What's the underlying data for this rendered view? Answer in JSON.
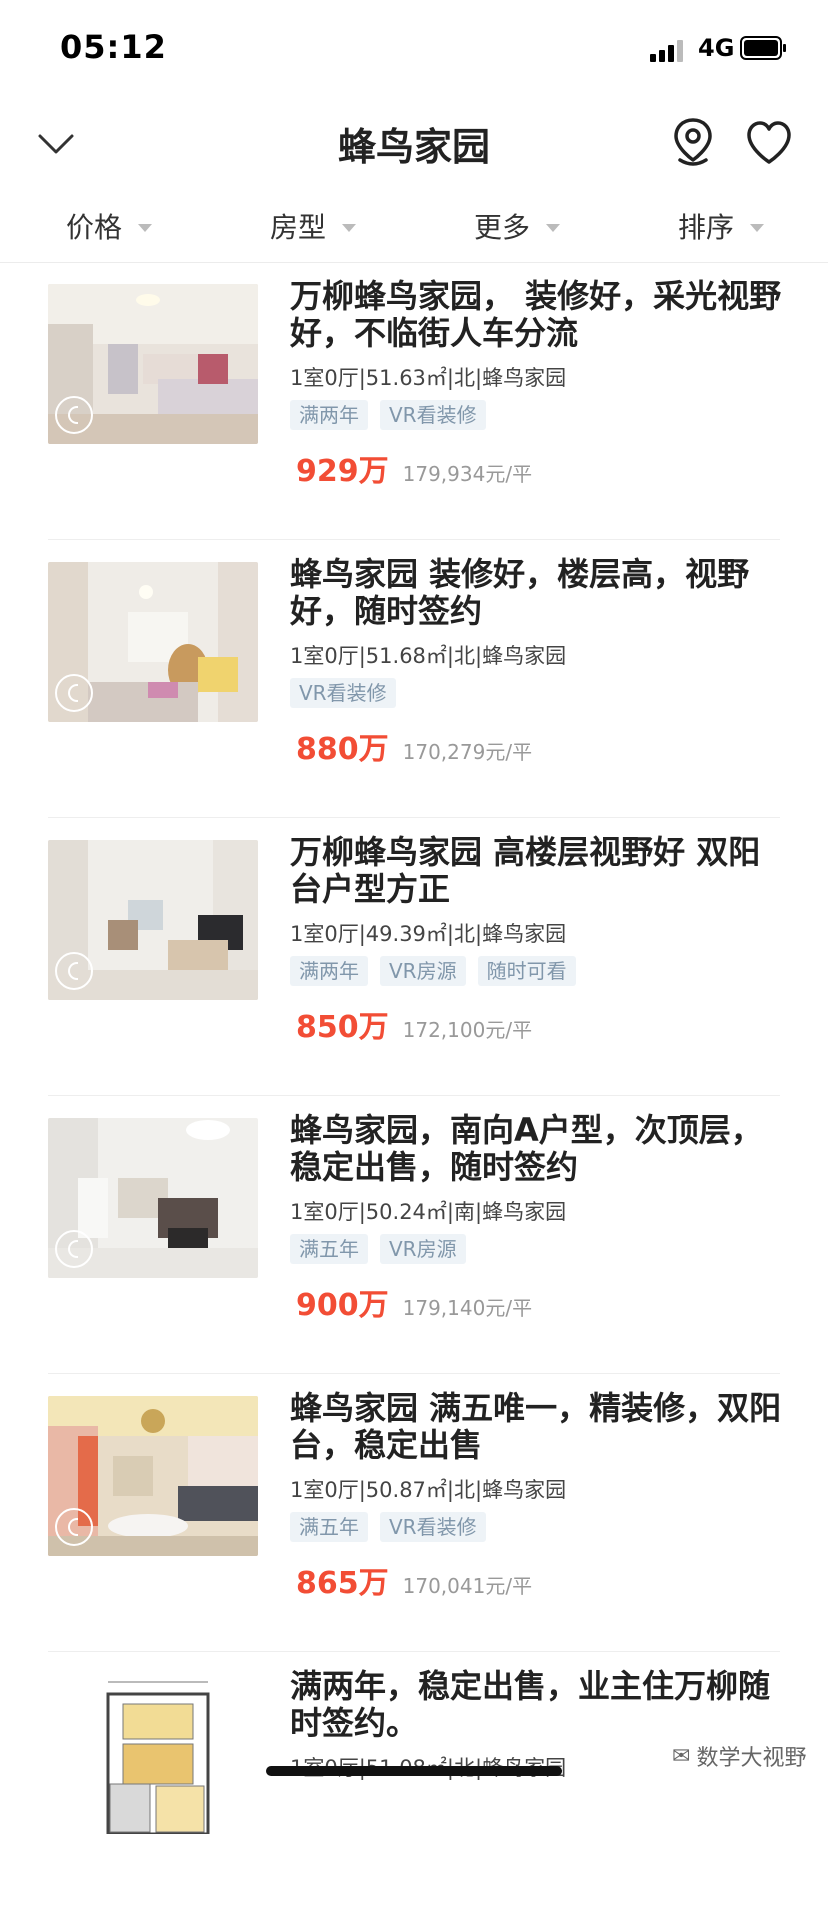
{
  "status": {
    "time": "05:12",
    "network": "4G"
  },
  "nav": {
    "title": "蜂鸟家园"
  },
  "filters": [
    {
      "label": "价格"
    },
    {
      "label": "房型"
    },
    {
      "label": "更多"
    },
    {
      "label": "排序"
    }
  ],
  "listings": [
    {
      "title": "万柳蜂鸟家园， 装修好，采光视野好，不临街人车分流",
      "meta": "1室0厅|51.63㎡|北|蜂鸟家园",
      "tags": [
        "满两年",
        "VR看装修"
      ],
      "price": "929万",
      "unit_price": "179,934元/平"
    },
    {
      "title": "蜂鸟家园 装修好，楼层高，视野好，随时签约",
      "meta": "1室0厅|51.68㎡|北|蜂鸟家园",
      "tags": [
        "VR看装修"
      ],
      "price": "880万",
      "unit_price": "170,279元/平"
    },
    {
      "title": "万柳蜂鸟家园 高楼层视野好 双阳台户型方正",
      "meta": "1室0厅|49.39㎡|北|蜂鸟家园",
      "tags": [
        "满两年",
        "VR房源",
        "随时可看"
      ],
      "price": "850万",
      "unit_price": "172,100元/平"
    },
    {
      "title": "蜂鸟家园，南向A户型，次顶层，稳定出售，随时签约",
      "meta": "1室0厅|50.24㎡|南|蜂鸟家园",
      "tags": [
        "满五年",
        "VR房源"
      ],
      "price": "900万",
      "unit_price": "179,140元/平"
    },
    {
      "title": "蜂鸟家园 满五唯一，精装修，双阳台，稳定出售",
      "meta": "1室0厅|50.87㎡|北|蜂鸟家园",
      "tags": [
        "满五年",
        "VR看装修"
      ],
      "price": "865万",
      "unit_price": "170,041元/平"
    },
    {
      "title": "满两年，稳定出售，业主住万柳随时签约。",
      "meta": "1室0厅|51.08㎡|北|蜂鸟家园"
    }
  ],
  "watermark": "数学大视野"
}
